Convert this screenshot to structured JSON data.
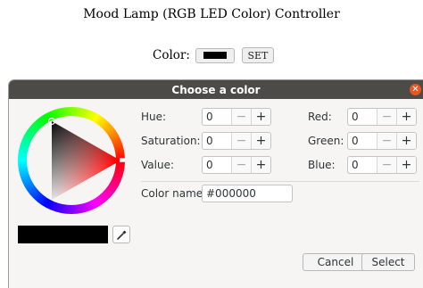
{
  "page": {
    "title": "Mood Lamp (RGB LED Color) Controller",
    "color_label": "Color:",
    "current_color": "#000000",
    "set_button": "SET"
  },
  "dialog": {
    "title": "Choose a color",
    "hsv": [
      {
        "label": "Hue:",
        "value": "0"
      },
      {
        "label": "Saturation:",
        "value": "0"
      },
      {
        "label": "Value:",
        "value": "0"
      }
    ],
    "rgb": [
      {
        "label": "Red:",
        "value": "0"
      },
      {
        "label": "Green:",
        "value": "0"
      },
      {
        "label": "Blue:",
        "value": "0"
      }
    ],
    "color_name_label": "Color name:",
    "color_name_value": "#000000",
    "cancel_button": "Cancel",
    "select_button": "Select",
    "icons": {
      "close": "close-icon",
      "picker": "eyedropper-icon",
      "minus": "minus-icon",
      "plus": "plus-icon"
    }
  }
}
